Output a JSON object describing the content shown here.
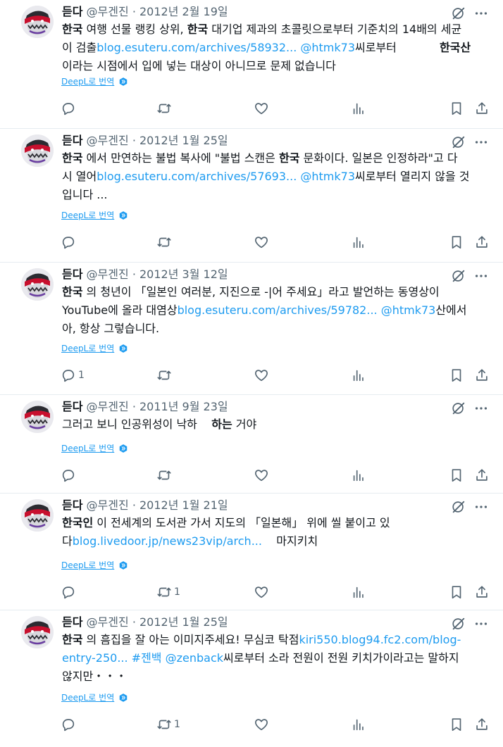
{
  "labels": {
    "translate": "DeepL로 번역"
  },
  "tweets": [
    {
      "name": "듣다",
      "handle": "@무겐진",
      "sep": "·",
      "date": "2012년 2월 19일",
      "lines": [
        [
          {
            "t": "한국",
            "s": "b"
          },
          {
            "t": " 여행 선물 랭킹 상위, "
          },
          {
            "t": "한국",
            "s": "b"
          },
          {
            "t": " 대기업 제과의 초콜릿으로부터 기준치의 14배의 세균"
          }
        ],
        [
          {
            "t": "이 검출"
          },
          {
            "t": "blog.esuteru.com/archives/58932...",
            "s": "link"
          },
          {
            "t": " "
          },
          {
            "t": "@htmk73",
            "s": "link"
          },
          {
            "t": "씨로부터            "
          },
          {
            "t": "한국산",
            "s": "b"
          }
        ],
        [
          {
            "t": "이라는 시점에서 입에 넣는 대상이 아니므로 문제 없습니다"
          }
        ]
      ],
      "replies": "",
      "retweets": ""
    },
    {
      "name": "듣다",
      "handle": "@무겐진",
      "sep": "·",
      "date": "2012년 1월 25일",
      "lines": [
        [
          {
            "t": "한국",
            "s": "b"
          },
          {
            "t": " 에서 만연하는 불법 복사에 \"불법 스캔은 "
          },
          {
            "t": "한국",
            "s": "b"
          },
          {
            "t": " 문화이다. 일본은 인정하라\"고 다"
          }
        ],
        [
          {
            "t": "시 열어"
          },
          {
            "t": "blog.esuteru.com/archives/57693...",
            "s": "link"
          },
          {
            "t": " "
          },
          {
            "t": "@htmk73",
            "s": "link"
          },
          {
            "t": "씨로부터 열리지 않을 것"
          }
        ],
        [
          {
            "t": "입니다 ..."
          }
        ]
      ],
      "replies": "",
      "retweets": ""
    },
    {
      "name": "듣다",
      "handle": "@무겐진",
      "sep": "·",
      "date": "2012년 3월 12일",
      "lines": [
        [
          {
            "t": "한국",
            "s": "b"
          },
          {
            "t": " 의 청년이 「일본인 여러분, 지진으로 -|어 주세요」라고 발언하는 동영상이"
          }
        ],
        [
          {
            "t": "YouTube에 올라 대염상"
          },
          {
            "t": "blog.esuteru.com/archives/59782...",
            "s": "link"
          },
          {
            "t": " "
          },
          {
            "t": "@htmk73",
            "s": "link"
          },
          {
            "t": "산에서"
          }
        ],
        [
          {
            "t": "아, 항상 그렇습니다."
          }
        ]
      ],
      "replies": "1",
      "retweets": ""
    },
    {
      "name": "듣다",
      "handle": "@무겐진",
      "sep": "·",
      "date": "2011년 9월 23일",
      "lines": [
        [
          {
            "t": "그러고 보니 인공위성이 낙하    "
          },
          {
            "t": "하는",
            "s": "b"
          },
          {
            "t": " 거야"
          }
        ]
      ],
      "replies": "",
      "retweets": ""
    },
    {
      "name": "듣다",
      "handle": "@무겐진",
      "sep": "·",
      "date": "2012년 1월 21일",
      "lines": [
        [
          {
            "t": "한국인",
            "s": "b"
          },
          {
            "t": " 이 전세계의 도서관 가서 지도의 「일본해」 위에 씰 붙이고 있"
          }
        ],
        [
          {
            "t": "다"
          },
          {
            "t": "blog.livedoor.jp/news23vip/arch...",
            "s": "link"
          },
          {
            "t": "    마지키치"
          }
        ]
      ],
      "replies": "",
      "retweets": "1"
    },
    {
      "name": "듣다",
      "handle": "@무겐진",
      "sep": "·",
      "date": "2012년 1월 25일",
      "lines": [
        [
          {
            "t": "한국",
            "s": "b"
          },
          {
            "t": " 의 흠집을 잘 아는 이미지주세요! 무심코 탁점"
          },
          {
            "t": "kiri550.blog94.fc2.com/blog-",
            "s": "link"
          }
        ],
        [
          {
            "t": "entry-250... #젠백",
            "s": "link"
          },
          {
            "t": " "
          },
          {
            "t": "@zenback",
            "s": "link"
          },
          {
            "t": "씨로부터 소라 전원이 전원 키치가이라고는 말하지"
          }
        ],
        [
          {
            "t": "않지만・・・"
          }
        ]
      ],
      "replies": "",
      "retweets": "1"
    }
  ]
}
